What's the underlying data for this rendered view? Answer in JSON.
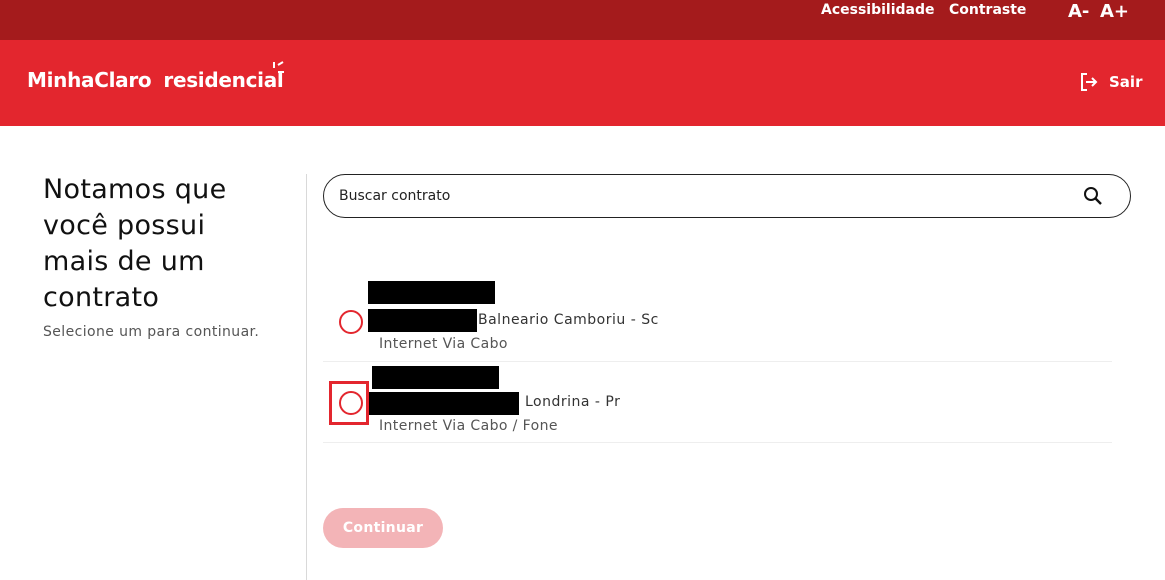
{
  "topbar": {
    "accessibility_label": "Acessibilidade",
    "contrast_label": "Contraste",
    "font_decrease_label": "A-",
    "font_increase_label": "A+"
  },
  "header": {
    "logo": {
      "part1": "MinhaClaro",
      "part2": "residencial"
    },
    "logout_label": "Sair"
  },
  "intro": {
    "title": "Notamos que você possui mais de um contrato",
    "subtitle": "Selecione um para continuar."
  },
  "search": {
    "placeholder": "Buscar contrato",
    "value": ""
  },
  "contracts": [
    {
      "city": "Balneario Camboriu - Sc",
      "service": "Internet Via Cabo",
      "selected": false
    },
    {
      "city": "Londrina - Pr",
      "service": "Internet Via Cabo / Fone",
      "selected": false
    }
  ],
  "actions": {
    "continue_label": "Continuar"
  },
  "colors": {
    "brand_red": "#e3262e",
    "topbar_dark_red": "#a41b1c",
    "button_disabled": "#f3b4b7"
  },
  "icons": [
    "logout-icon",
    "search-icon"
  ]
}
